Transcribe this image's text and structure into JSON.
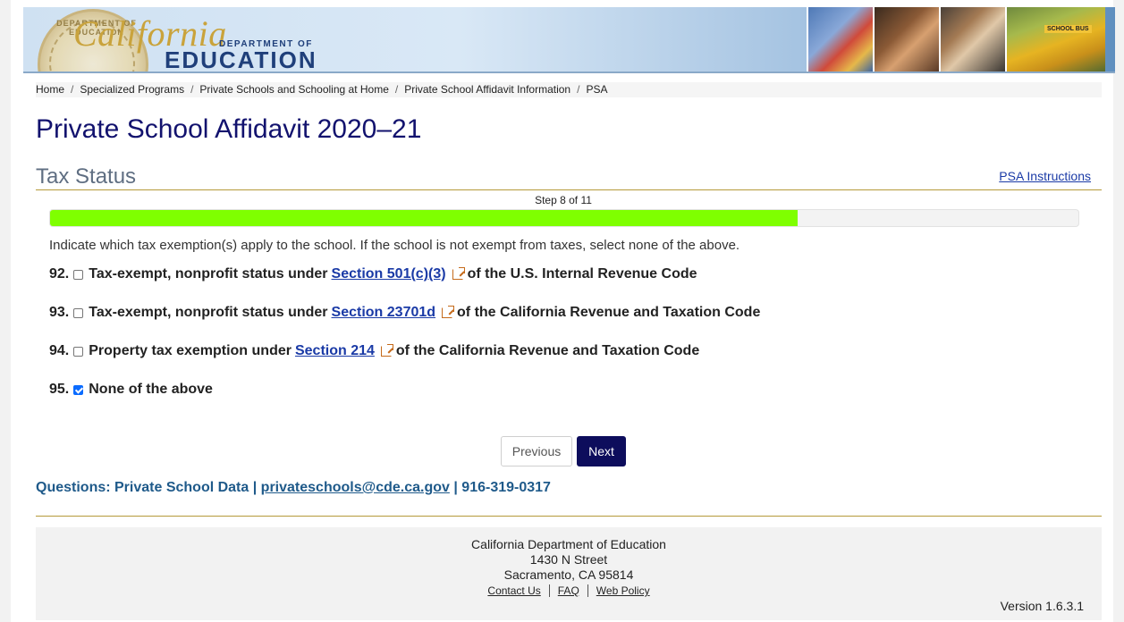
{
  "header": {
    "logo_script": "California",
    "logo_dept": "DEPARTMENT OF",
    "logo_edu": "EDUCATION",
    "seal_text": "DEPARTMENT OF EDUCATION",
    "bus_sign": "SCHOOL BUS"
  },
  "breadcrumb": [
    "Home",
    "Specialized Programs",
    "Private Schools and Schooling at Home",
    "Private School Affidavit Information",
    "PSA"
  ],
  "breadcrumb_sep": "/",
  "page_title": "Private School Affidavit 2020–21",
  "section_title": "Tax Status",
  "psa_instructions_link": "PSA Instructions",
  "step_text": "Step 8 of 11",
  "progress": {
    "current": 8,
    "total": 11,
    "fraction": 0.727,
    "fill_color": "#7fff00"
  },
  "instructions": "Indicate which tax exemption(s) apply to the school. If the school is not exempt from taxes, select none of the above.",
  "questions": [
    {
      "number": "92.",
      "checked": false,
      "before": "Tax-exempt, nonprofit status under",
      "link": "Section 501(c)(3)",
      "after": "of the U.S. Internal Revenue Code"
    },
    {
      "number": "93.",
      "checked": false,
      "before": "Tax-exempt, nonprofit status under",
      "link": "Section 23701d",
      "after": "of the California Revenue and Taxation Code"
    },
    {
      "number": "94.",
      "checked": false,
      "before": "Property tax exemption under",
      "link": "Section 214",
      "after": "of the California Revenue and Taxation Code"
    },
    {
      "number": "95.",
      "checked": true,
      "label": "None of the above"
    }
  ],
  "buttons": {
    "previous": "Previous",
    "next": "Next"
  },
  "contact": {
    "label": "Questions: Private School Data",
    "sep": "|",
    "email": "privateschools@cde.ca.gov",
    "phone": "916-319-0317"
  },
  "footer": {
    "org": "California Department of Education",
    "street": "1430 N Street",
    "city": "Sacramento, CA 95814",
    "links": [
      "Contact Us",
      "FAQ",
      "Web Policy"
    ],
    "version": "Version 1.6.3.1"
  },
  "colors": {
    "title": "#12126e",
    "link": "#1a3aa6",
    "next_button": "#0d0d5c",
    "progress_fill": "#7fff00",
    "gold_rule": "#b59a3a",
    "contact": "#1f5a8a"
  },
  "icons": [
    "external-link-icon",
    "checkbox-unchecked-icon",
    "checkbox-checked-icon"
  ]
}
